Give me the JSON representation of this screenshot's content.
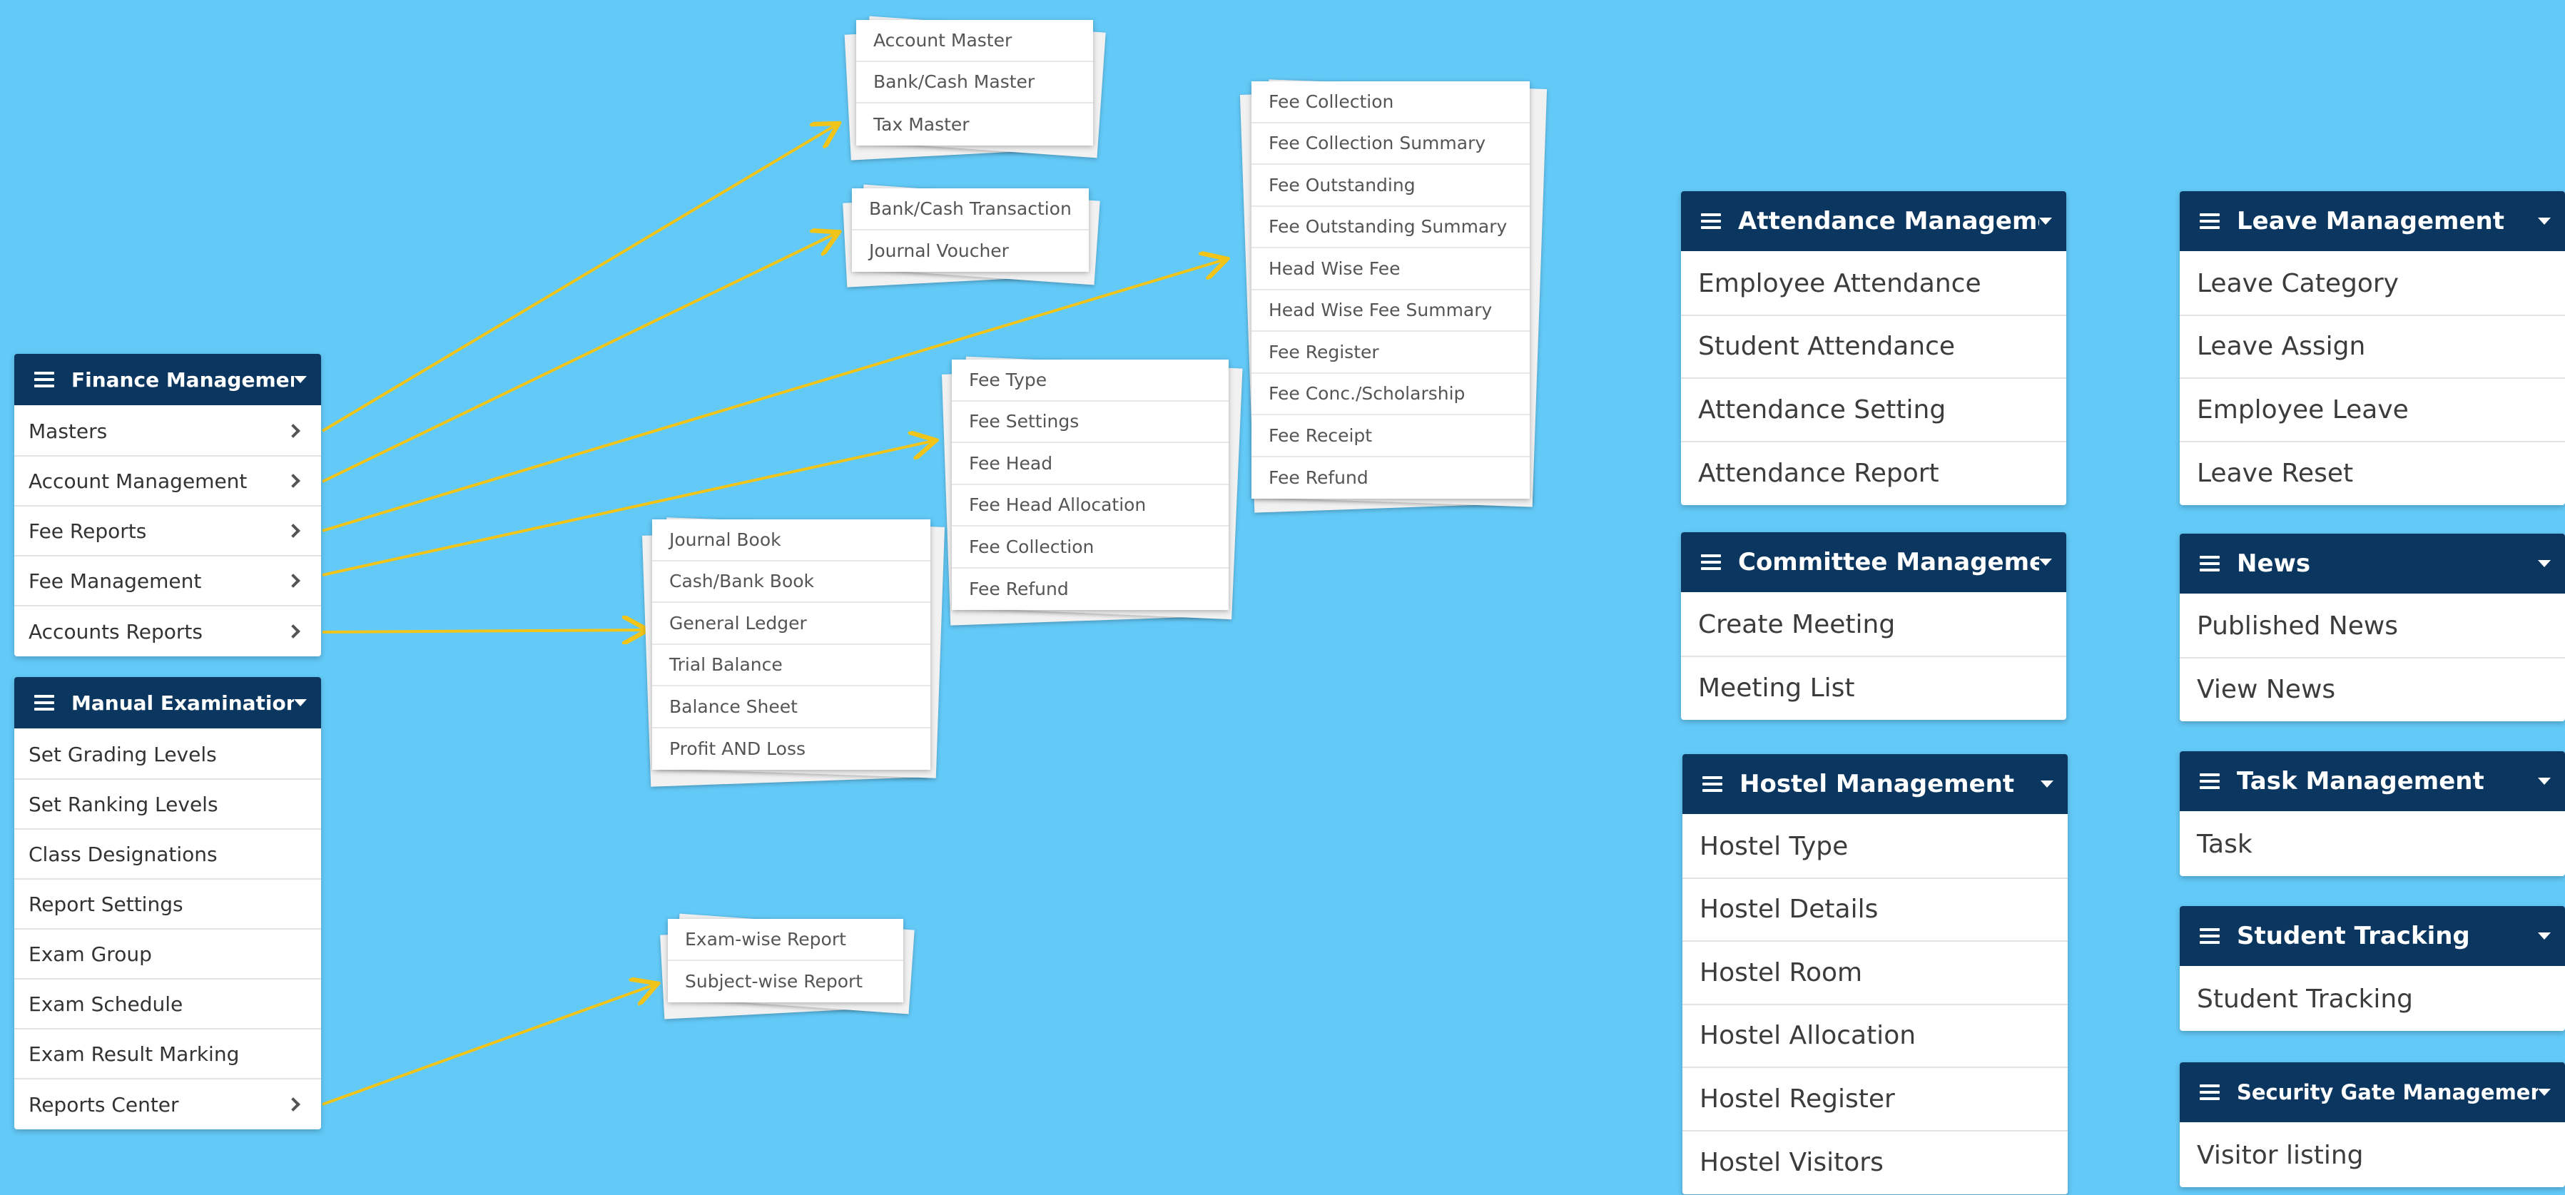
{
  "finance": {
    "title": "Finance Management",
    "items": [
      {
        "label": "Masters"
      },
      {
        "label": "Account Management"
      },
      {
        "label": "Fee Reports"
      },
      {
        "label": "Fee Management"
      },
      {
        "label": "Accounts Reports"
      }
    ]
  },
  "manual_exam": {
    "title": "Manual Examination",
    "items": [
      {
        "label": "Set Grading Levels"
      },
      {
        "label": "Set Ranking Levels"
      },
      {
        "label": "Class Designations"
      },
      {
        "label": "Report Settings"
      },
      {
        "label": "Exam Group"
      },
      {
        "label": "Exam Schedule"
      },
      {
        "label": "Exam Result Marking"
      },
      {
        "label": "Reports Center"
      }
    ]
  },
  "submenus": {
    "masters": [
      "Account Master",
      "Bank/Cash Master",
      "Tax Master"
    ],
    "account_mgmt": [
      "Bank/Cash Transaction",
      "Journal Voucher"
    ],
    "fee_reports": [
      "Fee Collection",
      "Fee Collection Summary",
      "Fee Outstanding",
      "Fee Outstanding Summary",
      "Head Wise Fee",
      "Head Wise Fee Summary",
      "Fee Register",
      "Fee Conc./Scholarship",
      "Fee Receipt",
      "Fee Refund"
    ],
    "fee_mgmt": [
      "Fee Type",
      "Fee Settings",
      "Fee Head",
      "Fee Head Allocation",
      "Fee Collection",
      "Fee Refund"
    ],
    "accounts_reports": [
      "Journal Book",
      "Cash/Bank Book",
      "General Ledger",
      "Trial Balance",
      "Balance Sheet",
      "Profit AND Loss"
    ],
    "reports_center": [
      "Exam-wise Report",
      "Subject-wise Report"
    ]
  },
  "attendance": {
    "title": "Attendance Management",
    "items": [
      "Employee Attendance",
      "Student Attendance",
      "Attendance Setting",
      "Attendance Report"
    ]
  },
  "committee": {
    "title": "Committee Management",
    "items": [
      "Create Meeting",
      "Meeting List"
    ]
  },
  "hostel": {
    "title": "Hostel Management",
    "items": [
      "Hostel Type",
      "Hostel Details",
      "Hostel Room",
      "Hostel Allocation",
      "Hostel Register",
      "Hostel Visitors"
    ]
  },
  "leave": {
    "title": "Leave Management",
    "items": [
      "Leave Category",
      "Leave Assign",
      "Employee Leave",
      "Leave Reset"
    ]
  },
  "news": {
    "title": "News",
    "items": [
      "Published News",
      "View News"
    ]
  },
  "task": {
    "title": "Task Management",
    "items": [
      "Task"
    ]
  },
  "student_tracking": {
    "title": "Student Tracking",
    "items": [
      "Student Tracking"
    ]
  },
  "security_gate": {
    "title": "Security Gate Management",
    "items": [
      "Visitor listing"
    ]
  },
  "colors": {
    "background": "#63c9f7",
    "header": "#0b365f",
    "arrow": "#f0c419"
  },
  "icons": {
    "header_menu": "hamburger-icon",
    "header_toggle": "caret-down-icon",
    "item_expand": "chevron-right-icon"
  }
}
